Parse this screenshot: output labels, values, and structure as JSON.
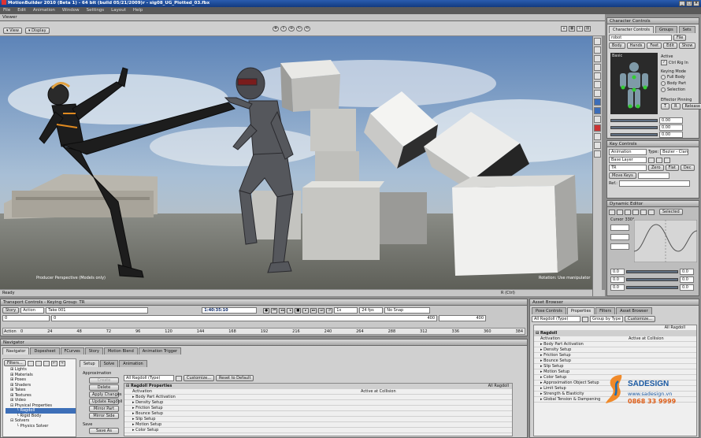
{
  "app": {
    "title": "MotionBuilder 2010 (Beta 1)  -  64 bit (build 05/21/2009)r  -  sig08_UG_Plotted_03.fbx",
    "menu": [
      "File",
      "Edit",
      "Animation",
      "Window",
      "Settings",
      "Layout",
      "Help"
    ]
  },
  "viewer": {
    "title": "Viewer",
    "view_btn": "View",
    "display_btn": "Display",
    "camera_label": "Producer Perspective (Models only)",
    "rotation_label": "Rotation: Use manipulator",
    "status_left": "Ready",
    "status_mid": "R (Ctrl)"
  },
  "character_controls": {
    "title": "Character Controls",
    "tabs": [
      "Character Controls",
      "Groups",
      "Sets"
    ],
    "character_name": "robot",
    "file_btn": "File",
    "subtabs": [
      "Body",
      "Hands",
      "Feet",
      "Edit",
      "Show"
    ],
    "basic_label": "Basic",
    "active_label": "Active",
    "ctrl_rig_label": "Ctrl Rig In",
    "keying_mode_label": "Keying Mode",
    "full_body": "Full Body",
    "body_part": "Body Part",
    "selection": "Selection",
    "effector_pinning": "Effector Pinning",
    "t_btn": "T",
    "r_btn": "R",
    "release_btn": "Release",
    "slider_values": [
      "0.00",
      "0.00",
      "0.00"
    ]
  },
  "key_controls": {
    "title": "Key Controls",
    "animation_field": "Animation",
    "type_label": "Type:",
    "type_value": "Bezier - Clamp",
    "base_layer": "Base Layer",
    "tr_field": "TR",
    "move_keys": "Move Keys",
    "zero_btn": "Zero",
    "flat_btn": "Flat",
    "dec_btn": "Dec",
    "ref_label": "Ref.:"
  },
  "dynamic_editor": {
    "title": "Dynamic Editor",
    "selected_tab": "Selected",
    "cursor_label": "Cursor",
    "cursor_value": "330°",
    "left_values": [
      "0.0",
      "0.0",
      "0.0"
    ],
    "right_values": [
      "0.0",
      "0.0",
      "0.0"
    ]
  },
  "transport": {
    "title": "Transport Controls  -  Keying Group: TR",
    "story_btn": "Story",
    "action_field": "Action",
    "take_field": "Take 001",
    "timecode": "1:40:35:10",
    "fps_field": "1x",
    "fps_value": "24 fps",
    "snap_field": "No Snap",
    "start_value": "0",
    "end_value": "400",
    "end_value2": "400",
    "zero_value": "0",
    "action_label": "Action",
    "ticks": [
      "0",
      "24",
      "48",
      "72",
      "96",
      "120",
      "144",
      "168",
      "192",
      "216",
      "240",
      "264",
      "288",
      "312",
      "336",
      "360",
      "384"
    ]
  },
  "navigator": {
    "title": "Navigator",
    "tabs": [
      "Navigator",
      "Dopesheet",
      "FCurves",
      "Story",
      "Motion Blend",
      "Animation Trigger"
    ],
    "filters_btn": "Filters...",
    "tree": [
      {
        "label": "Lights",
        "indent": 1
      },
      {
        "label": "Materials",
        "indent": 1
      },
      {
        "label": "Poses",
        "indent": 1
      },
      {
        "label": "Shaders",
        "indent": 1
      },
      {
        "label": "Takes",
        "indent": 1
      },
      {
        "label": "Textures",
        "indent": 1
      },
      {
        "label": "Video",
        "indent": 1
      },
      {
        "label": "Physical Properties",
        "indent": 1
      },
      {
        "label": "Ragdoll",
        "indent": 2
      },
      {
        "label": "Rigid Body",
        "indent": 2
      },
      {
        "label": "Solvers",
        "indent": 1
      },
      {
        "label": "Physics Solver",
        "indent": 2
      }
    ],
    "subtabs": [
      "Setup",
      "Solve",
      "Animation"
    ],
    "approximation_label": "Approximation",
    "buttons": [
      "Create",
      "Delete",
      "Apply Changes",
      "Update Ragdoll",
      "Mirror Part",
      "Mirror Side"
    ],
    "save_label": "Save",
    "save_as_btn": "Save As",
    "all_ragdoll": "All Ragdoll (Type)",
    "customize_btn": "Customize...",
    "reset_btn": "Reset to Default",
    "props_header": "Ragdoll Properties",
    "props_filter": "All Ragdoll",
    "activation_label": "Activation",
    "activation_value": "Active at Collision",
    "props": [
      "Body Part Activation",
      "Density Setup",
      "Friction Setup",
      "Bounce Setup",
      "Slip Setup",
      "Motion Setup",
      "Color Setup"
    ]
  },
  "asset_browser": {
    "title": "Asset Browser",
    "tabs": [
      "Pose Controls",
      "Properties",
      "Filters",
      "Asset Browser"
    ],
    "all_ragdoll": "All Ragdoll (Type)",
    "group_by": "Group by Type",
    "customize_btn": "Customize...",
    "filter_label": "All Ragdoll",
    "ragdoll_header": "Ragdoll",
    "activation_label": "Activation",
    "activation_value": "Active at Collision",
    "props": [
      "Body Part Activation",
      "Density Setup",
      "Friction Setup",
      "Bounce Setup",
      "Slip Setup",
      "Motion Setup",
      "Color Setup",
      "Approximation Object Setup",
      "Limit Setup",
      "Strength & Elasticity",
      "Global Tension & Dampening"
    ]
  },
  "watermark": {
    "brand": "SADESIGN",
    "url": "www.sadesign.vn",
    "phone": "0868 33 9999"
  }
}
